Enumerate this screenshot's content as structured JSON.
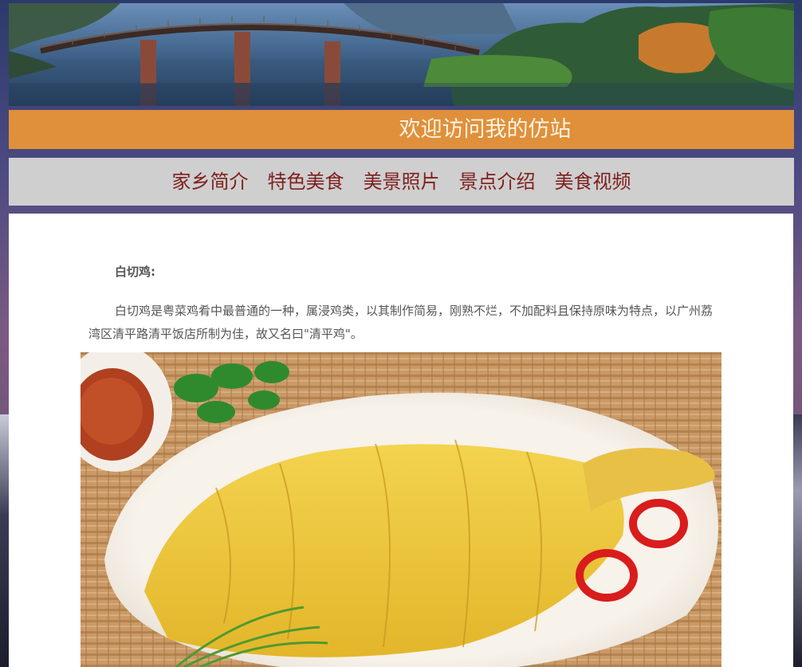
{
  "header": {
    "banner_alt": "lake-bridge-scenery",
    "title": "欢迎访问我的仿站"
  },
  "nav": {
    "items": [
      {
        "label": "家乡简介"
      },
      {
        "label": "特色美食"
      },
      {
        "label": "美景照片"
      },
      {
        "label": "景点介绍"
      },
      {
        "label": "美食视频"
      }
    ]
  },
  "article": {
    "dish_title": "白切鸡:",
    "dish_description": "白切鸡是粤菜鸡肴中最普通的一种，属浸鸡类，以其制作简易，刚熟不烂，不加配料且保持原味为特点，以广州荔湾区清平路清平饭店所制为佳，故又名曰\"清平鸡\"。",
    "photo_alt": "white-cut-chicken-photo"
  },
  "colors": {
    "title_bar": "#e0903a",
    "nav_bar": "#cfcfcf",
    "nav_text": "#7f1f1f",
    "title_text": "#fbf3e6",
    "body_text": "#555555"
  }
}
